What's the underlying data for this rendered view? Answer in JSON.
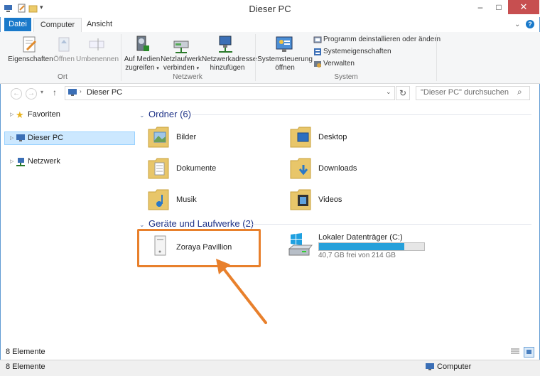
{
  "window": {
    "title": "Dieser PC"
  },
  "tabs": [
    {
      "label": "Datei"
    },
    {
      "label": "Computer"
    },
    {
      "label": "Ansicht"
    }
  ],
  "ribbon": {
    "groups": [
      {
        "label": "Ort"
      },
      {
        "label": "Netzwerk"
      },
      {
        "label": "System"
      }
    ],
    "eigenschaften": "Eigenschaften",
    "oeffnen": "Öffnen",
    "umbenennen": "Umbenennen",
    "medien_l1": "Auf Medien",
    "medien_l2": "zugreifen",
    "netzlaufwerk_l1": "Netzlaufwerk",
    "netzlaufwerk_l2": "verbinden",
    "netzwerkadresse_l1": "Netzwerkadresse",
    "netzwerkadresse_l2": "hinzufügen",
    "systemsteuerung_l1": "Systemsteuerung",
    "systemsteuerung_l2": "öffnen",
    "programm": "Programm deinstallieren oder ändern",
    "systemeigenschaften": "Systemeigenschaften",
    "verwalten": "Verwalten"
  },
  "address": {
    "path": "Dieser PC",
    "search_placeholder": "\"Dieser PC\" durchsuchen"
  },
  "nav": {
    "favoriten": "Favoriten",
    "dieser_pc": "Dieser PC",
    "netzwerk": "Netzwerk"
  },
  "content": {
    "ordner_header": "Ordner (6)",
    "folders": [
      {
        "label": "Bilder"
      },
      {
        "label": "Desktop"
      },
      {
        "label": "Dokumente"
      },
      {
        "label": "Downloads"
      },
      {
        "label": "Musik"
      },
      {
        "label": "Videos"
      }
    ],
    "devices_header": "Geräte und Laufwerke (2)",
    "device": {
      "label": "Zoraya Pavillion"
    },
    "drive": {
      "label": "Lokaler Datenträger (C:)",
      "free_text": "40,7 GB frei von 214 GB",
      "used_fraction": 0.81
    }
  },
  "status": {
    "count_top": "8 Elemente",
    "count_bottom": "8 Elemente",
    "right": "Computer"
  },
  "colors": {
    "accent": "#1979ca",
    "highlight": "#e8802c",
    "drive_bar": "#26a0da"
  }
}
